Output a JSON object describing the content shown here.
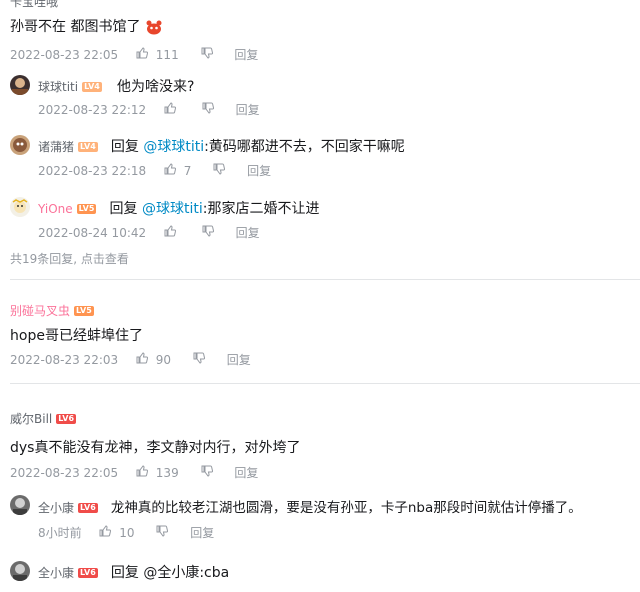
{
  "top_comment": {
    "user": "卡宝哇哦",
    "text": "孙哥不在 都图书馆了",
    "time": "2022-08-23 22:05",
    "likes": "111",
    "reply": "回复"
  },
  "sub_replies_1": [
    {
      "user": "球球titi",
      "level": "LV4",
      "text": "他为啥没来?",
      "time": "2022-08-23 22:12",
      "likes": "",
      "reply": "回复"
    },
    {
      "user": "诸蒲猪",
      "level": "LV4",
      "text": ":黄码哪都进不去，不回家干嘛呢",
      "reply_prefix": "回复",
      "mention": "@球球titi",
      "time": "2022-08-23 22:18",
      "likes": "7",
      "reply": "回复"
    },
    {
      "user": "YiOne",
      "level": "LV5",
      "text": ":那家店二婚不让进",
      "reply_prefix": "回复",
      "mention": "@球球titi",
      "time": "2022-08-24 10:42",
      "likes": "",
      "reply": "回复"
    }
  ],
  "more_replies": {
    "count_text": "共19条回复, ",
    "link": "点击查看"
  },
  "comment2": {
    "user": "别碰马叉虫",
    "level": "LV5",
    "text": "hope哥已经蚌埠住了",
    "time": "2022-08-23 22:03",
    "likes": "90",
    "reply": "回复"
  },
  "comment3": {
    "user": "威尔Bill",
    "level": "LV6",
    "text": "dys真不能没有龙神，李文静对内行，对外垮了",
    "time": "2022-08-23 22:05",
    "likes": "139",
    "reply": "回复"
  },
  "sub_replies_3": [
    {
      "user": "全小康",
      "level": "LV6",
      "text": "龙神真的比较老江湖也圆滑，要是没有孙亚，卡子nba那段时间就估计停播了。",
      "time": "8小时前",
      "likes": "10",
      "reply": "回复"
    },
    {
      "user": "全小康",
      "level": "LV6",
      "text": ":cba",
      "reply_prefix": "回复",
      "mention": "@全小康"
    }
  ],
  "colors": {
    "pink": "#fb7299",
    "link": "#008ac5",
    "meta": "#9499a0",
    "divider": "#e3e5e7"
  }
}
